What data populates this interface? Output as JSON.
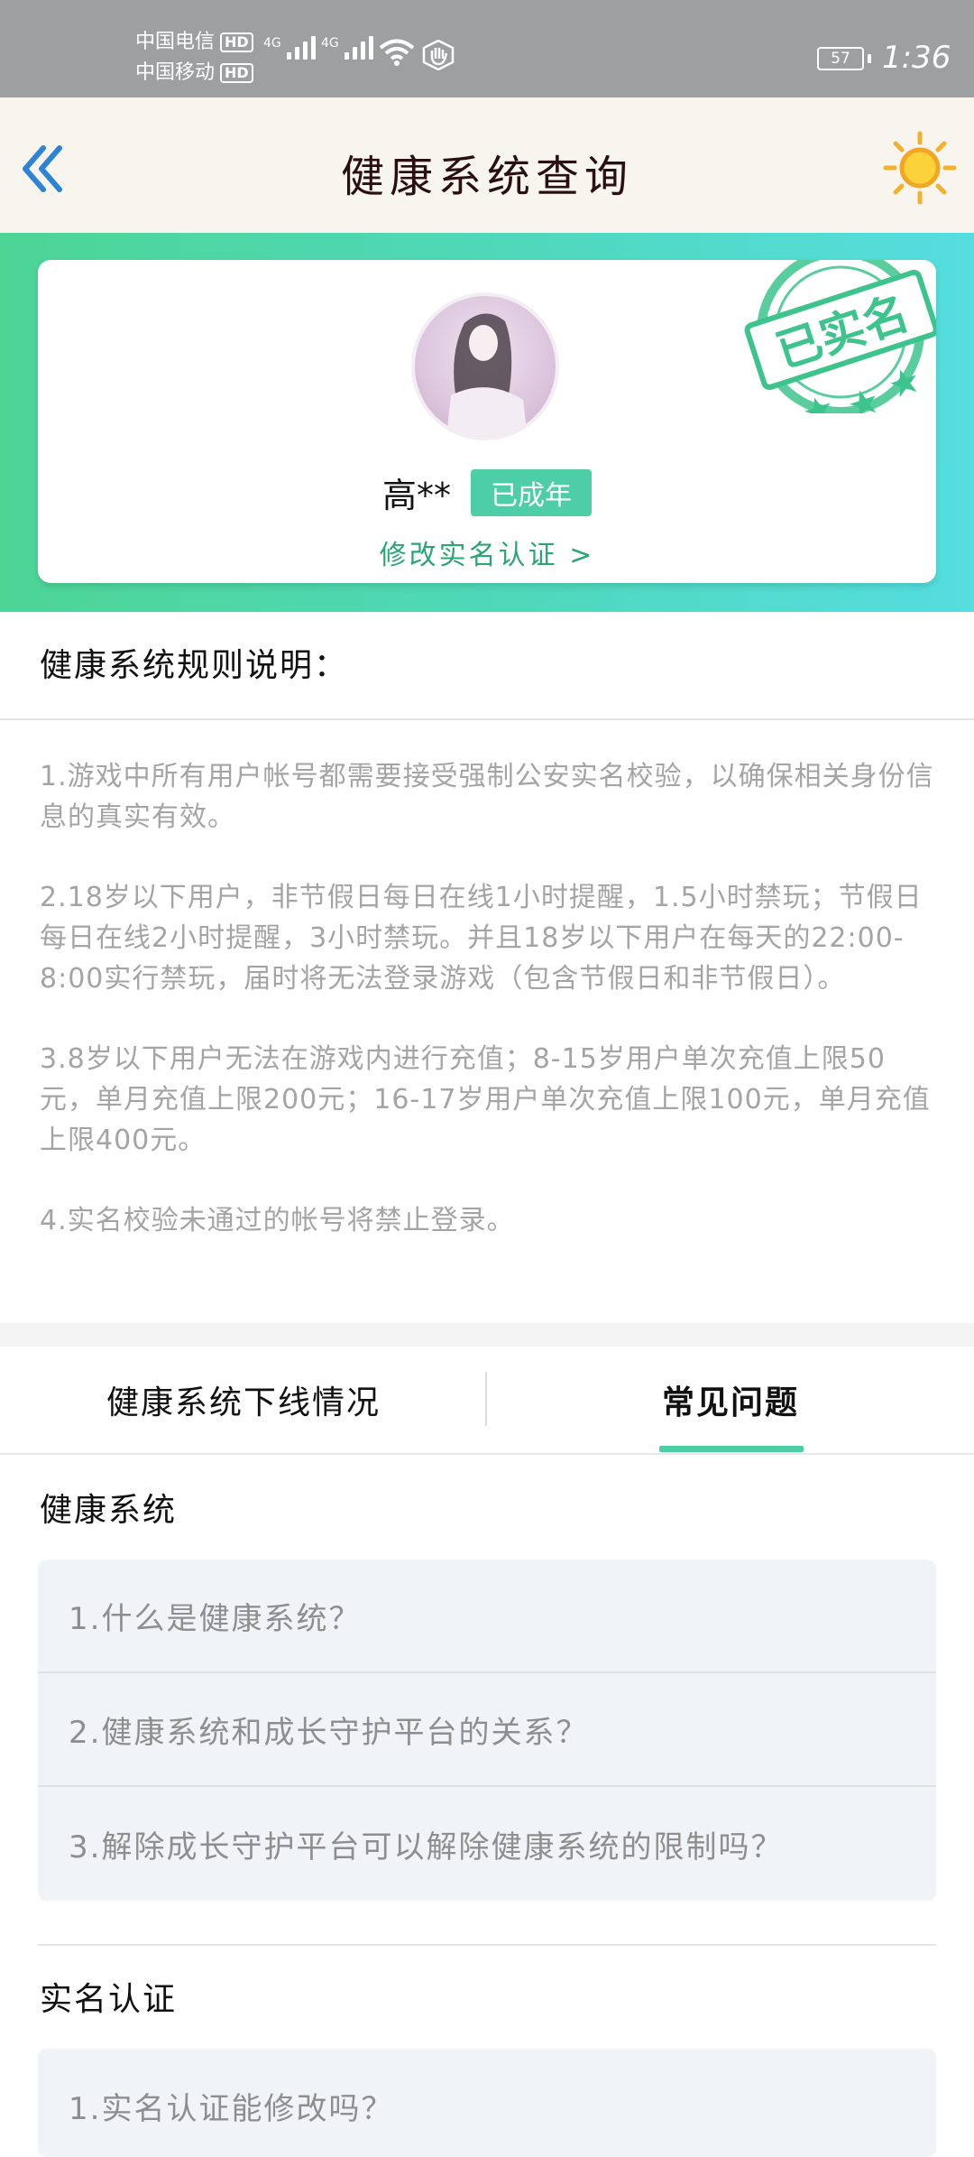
{
  "status_bar": {
    "carrier1": "中国电信",
    "carrier2": "中国移动",
    "hd": "HD",
    "net1": "4G",
    "net2": "4G",
    "battery": "57",
    "time": "1:36"
  },
  "header": {
    "title": "健康系统查询",
    "back_icon": "double-chevron-left-icon",
    "theme_icon": "sun-icon"
  },
  "profile": {
    "stamp_text": "已实名",
    "name": "高**",
    "age_badge": "已成年",
    "modify_link": "修改实名认证 >"
  },
  "rules": {
    "title": "健康系统规则说明：",
    "items": [
      "1.游戏中所有用户帐号都需要接受强制公安实名校验，以确保相关身份信息的真实有效。",
      "2.18岁以下用户，非节假日每日在线1小时提醒，1.5小时禁玩；节假日每日在线2小时提醒，3小时禁玩。并且18岁以下用户在每天的22:00-8:00实行禁玩，届时将无法登录游戏（包含节假日和非节假日）。",
      "3.8岁以下用户无法在游戏内进行充值；8-15岁用户单次充值上限50元，单月充值上限200元；16-17岁用户单次充值上限100元，单月充值上限400元。",
      "4.实名校验未通过的帐号将禁止登录。"
    ]
  },
  "tabs": {
    "left": "健康系统下线情况",
    "right": "常见问题",
    "active": "right"
  },
  "faq": {
    "section1_title": "健康系统",
    "section1_items": [
      "1.什么是健康系统？",
      "2.健康系统和成长守护平台的关系？",
      "3.解除成长守护平台可以解除健康系统的限制吗？"
    ],
    "section2_title": "实名认证",
    "section2_items": [
      "1.实名认证能修改吗？"
    ]
  },
  "colors": {
    "accent": "#4dcea6",
    "link": "#2aa574",
    "status_bar": "#9e9fa1",
    "header_bg": "#f8f5ee"
  }
}
